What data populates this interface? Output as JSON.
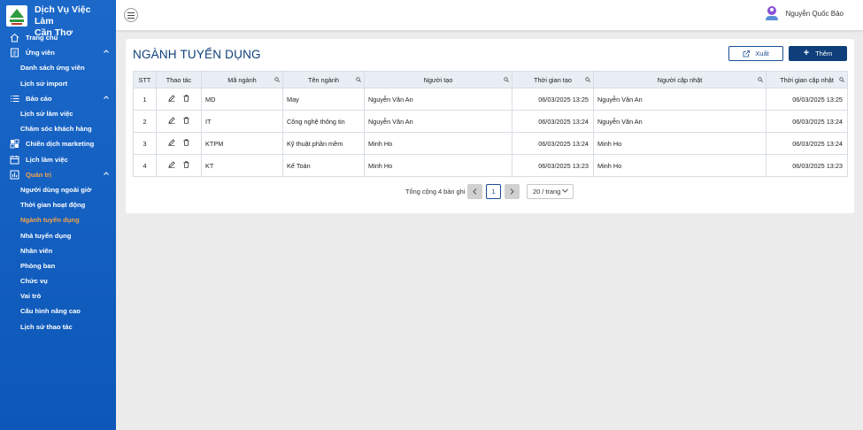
{
  "brand": {
    "line1": "Dịch Vụ Việc Làm",
    "line2": "Cần Thơ"
  },
  "nav": [
    {
      "label": "Trang chủ",
      "icon": "home-icon",
      "type": "top"
    },
    {
      "label": "Ứng viên",
      "icon": "document-icon",
      "type": "top",
      "expanded": true
    },
    {
      "label": "Danh sách ứng viên",
      "type": "sub"
    },
    {
      "label": "Lịch sử import",
      "type": "sub"
    },
    {
      "label": "Báo cáo",
      "icon": "list-icon",
      "type": "top",
      "expanded": true
    },
    {
      "label": "Lịch sử làm việc",
      "type": "sub"
    },
    {
      "label": "Chăm sóc khách hàng",
      "type": "sub"
    },
    {
      "label": "Chiến dịch marketing",
      "icon": "campaign-icon",
      "type": "top"
    },
    {
      "label": "Lịch làm việc",
      "icon": "calendar-icon",
      "type": "top"
    },
    {
      "label": "Quản trị",
      "icon": "admin-icon",
      "type": "top",
      "expanded": true,
      "active": true
    },
    {
      "label": "Người dùng ngoài giờ",
      "type": "sub"
    },
    {
      "label": "Thời gian hoạt động",
      "type": "sub"
    },
    {
      "label": "Ngành tuyển dụng",
      "type": "sub",
      "active": true
    },
    {
      "label": "Nhà tuyển dụng",
      "type": "sub"
    },
    {
      "label": "Nhân viên",
      "type": "sub"
    },
    {
      "label": "Phòng ban",
      "type": "sub"
    },
    {
      "label": "Chức vụ",
      "type": "sub"
    },
    {
      "label": "Vai trò",
      "type": "sub"
    },
    {
      "label": "Cấu hình nâng cao",
      "type": "sub"
    },
    {
      "label": "Lịch sử thao tác",
      "type": "sub"
    }
  ],
  "header": {
    "username": "Nguyễn Quốc Bảo"
  },
  "page": {
    "title": "NGÀNH TUYỂN DỤNG",
    "export_label": "Xuất",
    "add_label": "Thêm"
  },
  "table": {
    "columns": [
      "STT",
      "Thao tác",
      "Mã ngành",
      "Tên ngành",
      "Người tạo",
      "Thời gian tạo",
      "Người cập nhật",
      "Thời gian cập nhật"
    ],
    "rows": [
      {
        "stt": "1",
        "code": "MD",
        "name": "May",
        "creator": "Nguyễn Văn An",
        "created": "06/03/2025 13:25",
        "updater": "Nguyễn Văn An",
        "updated": "06/03/2025 13:25"
      },
      {
        "stt": "2",
        "code": "IT",
        "name": "Công nghệ thông tin",
        "creator": "Nguyễn Văn An",
        "created": "06/03/2025 13:24",
        "updater": "Nguyễn Văn An",
        "updated": "06/03/2025 13:24"
      },
      {
        "stt": "3",
        "code": "KTPM",
        "name": "Kỹ thuật phần mềm",
        "creator": "Minh Ho",
        "created": "06/03/2025 13:24",
        "updater": "Minh Ho",
        "updated": "06/03/2025 13:24"
      },
      {
        "stt": "4",
        "code": "KT",
        "name": "Kế Toán",
        "creator": "Minh Ho",
        "created": "06/03/2025 13:23",
        "updater": "Minh Ho",
        "updated": "06/03/2025 13:23"
      }
    ]
  },
  "pagination": {
    "total_text": "Tổng cộng 4 bản ghi",
    "current_page": "1",
    "page_size": "20 / trang"
  },
  "colors": {
    "sidebar": "#1b68c9",
    "accent": "#0e3f7a",
    "active_nav": "#f5a34a"
  }
}
